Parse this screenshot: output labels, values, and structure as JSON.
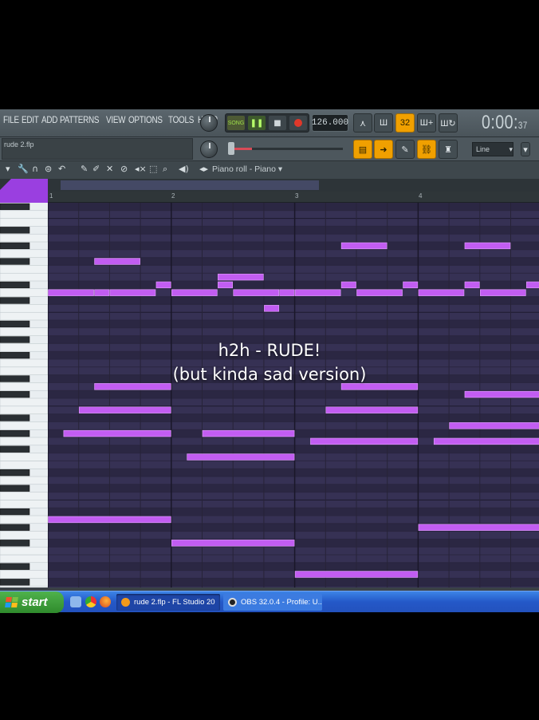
{
  "menu": [
    "FILE",
    "EDIT",
    "ADD",
    "PATTERNS",
    "VIEW",
    "OPTIONS",
    "TOOLS",
    "HELP"
  ],
  "transport": {
    "song_label": "SONG",
    "play_glyph": "❚❚",
    "stop_glyph": "■",
    "tempo": "126.000"
  },
  "tools": {
    "snap_value": "32",
    "time_main": "0:00:",
    "time_seconds": "37"
  },
  "project": {
    "file_name": "rude 2.flp"
  },
  "line_select": {
    "value": "Line",
    "arrow": "▾"
  },
  "piano_roll": {
    "title": "Piano roll - Piano ▾",
    "bar_numbers": [
      "1",
      "2",
      "3",
      "4"
    ]
  },
  "caption": {
    "line1": "h2h - RUDE!",
    "line2": "(but kinda sad version)"
  },
  "taskbar": {
    "start_label": "start",
    "items": [
      "rude 2.flp - FL Studio 20",
      "OBS 32.0.4 - Profile: U..."
    ]
  },
  "colors": {
    "note": "#c25df2",
    "grid_bg": "#312c4c",
    "accent": "#f0a000",
    "taskbar": "#2458c8"
  },
  "notes": [
    {
      "start": 0.0,
      "length": 1.5,
      "pitch": 38
    },
    {
      "start": 1.5,
      "length": 0.5,
      "pitch": 38
    },
    {
      "start": 2.0,
      "length": 1.5,
      "pitch": 38
    },
    {
      "start": 3.5,
      "length": 0.5,
      "pitch": 39
    },
    {
      "start": 4.0,
      "length": 1.5,
      "pitch": 38
    },
    {
      "start": 5.5,
      "length": 0.5,
      "pitch": 39
    },
    {
      "start": 6.0,
      "length": 1.5,
      "pitch": 38
    },
    {
      "start": 7.5,
      "length": 0.5,
      "pitch": 38
    },
    {
      "start": 8.0,
      "length": 1.5,
      "pitch": 38
    },
    {
      "start": 9.5,
      "length": 0.5,
      "pitch": 39
    },
    {
      "start": 10.0,
      "length": 1.5,
      "pitch": 38
    },
    {
      "start": 11.5,
      "length": 0.5,
      "pitch": 39
    },
    {
      "start": 12.0,
      "length": 1.5,
      "pitch": 38
    },
    {
      "start": 13.5,
      "length": 0.5,
      "pitch": 39
    },
    {
      "start": 14.0,
      "length": 1.5,
      "pitch": 38
    },
    {
      "start": 15.5,
      "length": 0.5,
      "pitch": 39
    },
    {
      "start": 1.5,
      "length": 1.5,
      "pitch": 42
    },
    {
      "start": 5.5,
      "length": 1.5,
      "pitch": 40
    },
    {
      "start": 7.0,
      "length": 0.5,
      "pitch": 36
    },
    {
      "start": 9.5,
      "length": 1.5,
      "pitch": 44
    },
    {
      "start": 13.5,
      "length": 1.5,
      "pitch": 44
    },
    {
      "start": 1.5,
      "length": 2.5,
      "pitch": 26
    },
    {
      "start": 1.0,
      "length": 3.0,
      "pitch": 23
    },
    {
      "start": 0.5,
      "length": 3.5,
      "pitch": 20
    },
    {
      "start": 5.0,
      "length": 3.0,
      "pitch": 20
    },
    {
      "start": 4.5,
      "length": 3.5,
      "pitch": 17
    },
    {
      "start": 9.5,
      "length": 2.5,
      "pitch": 26
    },
    {
      "start": 9.0,
      "length": 3.0,
      "pitch": 23
    },
    {
      "start": 8.5,
      "length": 3.5,
      "pitch": 19
    },
    {
      "start": 13.5,
      "length": 2.5,
      "pitch": 25
    },
    {
      "start": 13.0,
      "length": 3.0,
      "pitch": 21
    },
    {
      "start": 12.5,
      "length": 3.5,
      "pitch": 19
    },
    {
      "start": 0.0,
      "length": 4.0,
      "pitch": 9
    },
    {
      "start": 4.0,
      "length": 4.0,
      "pitch": 6
    },
    {
      "start": 8.0,
      "length": 4.0,
      "pitch": 2
    },
    {
      "start": 12.0,
      "length": 4.0,
      "pitch": 8
    }
  ]
}
